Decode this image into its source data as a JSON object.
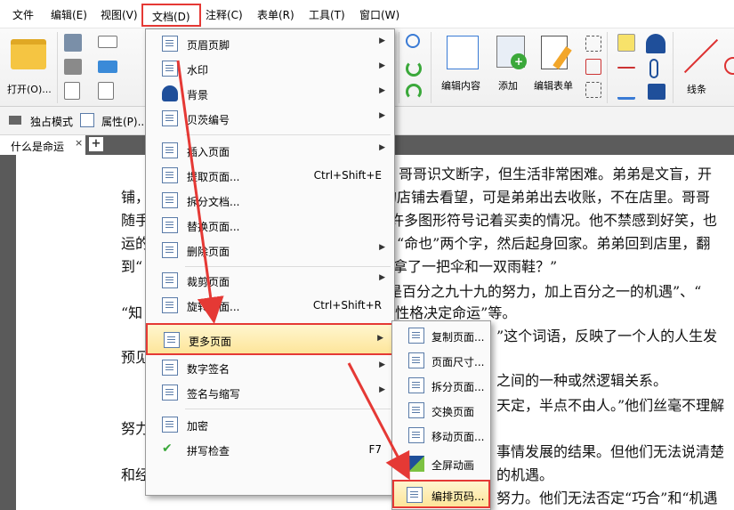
{
  "menubar": {
    "items": [
      "文件",
      "编辑(E)",
      "视图(V)",
      "文档(D)",
      "注释(C)",
      "表单(R)",
      "工具(T)",
      "窗口(W)"
    ]
  },
  "ribbon": {
    "open_label": "打开(O)...",
    "edit_content_label": "编辑内容",
    "add_label": "添加",
    "edit_form_label": "编辑表单",
    "lines_label": "线条"
  },
  "toolbar2": {
    "exclusive_mode": "独占模式",
    "properties": "属性(P)..."
  },
  "tabs": {
    "doc_tab": "什么是命运",
    "close": "×",
    "add": "+"
  },
  "document": {
    "lines": [
      "哥哥识文断字，但生活非常困难。弟弟是文盲，开",
      "铺，",
      "的店铺去看望，可是弟弟出去收账，不在店里。哥哥",
      "随手",
      "许多图形符号记着买卖的情况。他不禁感到好笑，也",
      "运的",
      "“命也”两个字，然后起身回家。弟弟回到店里，翻",
      "到“",
      "拿了一把伞和一双雨鞋？”",
      "是百分之九十九的努力，加上百分之一的机遇”、“",
      "“知",
      "“性格决定命运”等。",
      "”这个词语，反映了一个人的人生发",
      "预见",
      "之间的一种或然逻辑关系。",
      "天定，半点不由人。”他们丝毫不理解",
      "努力",
      "事情发展的结果。但他们无法说清楚",
      "和经",
      "的机遇。",
      "努力。他们无法否定“巧合”和“机遇"
    ]
  },
  "doc_menu": {
    "items": [
      {
        "label": "页眉页脚",
        "icon": "header-footer-icon",
        "shortcut": "",
        "submenu": true
      },
      {
        "label": "水印",
        "icon": "watermark-icon",
        "shortcut": "",
        "submenu": true
      },
      {
        "label": "背景",
        "icon": "background-icon",
        "shortcut": "",
        "submenu": true
      },
      {
        "label": "贝茨编号",
        "icon": "bates-number-icon",
        "shortcut": "",
        "submenu": true
      },
      {
        "label": "插入页面",
        "icon": "insert-page-icon",
        "shortcut": "",
        "submenu": true
      },
      {
        "label": "提取页面...",
        "icon": "extract-page-icon",
        "shortcut": "Ctrl+Shift+E",
        "submenu": false
      },
      {
        "label": "拆分文档...",
        "icon": "split-document-icon",
        "shortcut": "",
        "submenu": false
      },
      {
        "label": "替换页面...",
        "icon": "replace-page-icon",
        "shortcut": "",
        "submenu": false
      },
      {
        "label": "删除页面",
        "icon": "delete-page-icon",
        "shortcut": "",
        "submenu": true
      },
      {
        "label": "裁剪页面",
        "icon": "crop-page-icon",
        "shortcut": "",
        "submenu": true
      },
      {
        "label": "旋转页面...",
        "icon": "rotate-page-icon",
        "shortcut": "Ctrl+Shift+R",
        "submenu": false
      },
      {
        "label": "更多页面",
        "icon": "more-pages-icon",
        "shortcut": "",
        "submenu": true
      },
      {
        "label": "数字签名",
        "icon": "digital-signature-icon",
        "shortcut": "",
        "submenu": true
      },
      {
        "label": "签名与缩写",
        "icon": "sign-initials-icon",
        "shortcut": "",
        "submenu": true
      },
      {
        "label": "加密",
        "icon": "encrypt-icon",
        "shortcut": "",
        "submenu": false
      },
      {
        "label": "拼写检查",
        "icon": "spell-check-icon",
        "shortcut": "F7",
        "submenu": false
      }
    ]
  },
  "more_pages_submenu": {
    "items": [
      {
        "label": "复制页面...",
        "icon": "duplicate-page-icon"
      },
      {
        "label": "页面尺寸...",
        "icon": "page-size-icon"
      },
      {
        "label": "拆分页面...",
        "icon": "split-page-icon"
      },
      {
        "label": "交换页面",
        "icon": "swap-page-icon"
      },
      {
        "label": "移动页面...",
        "icon": "move-page-icon"
      },
      {
        "label": "全屏动画",
        "icon": "fullscreen-animation-icon"
      },
      {
        "label": "编排页码...",
        "icon": "page-numbering-icon"
      }
    ]
  },
  "colors": {
    "highlight_border": "#e53935",
    "arrow": "#e53935",
    "menu_highlight": "#fde59a"
  }
}
